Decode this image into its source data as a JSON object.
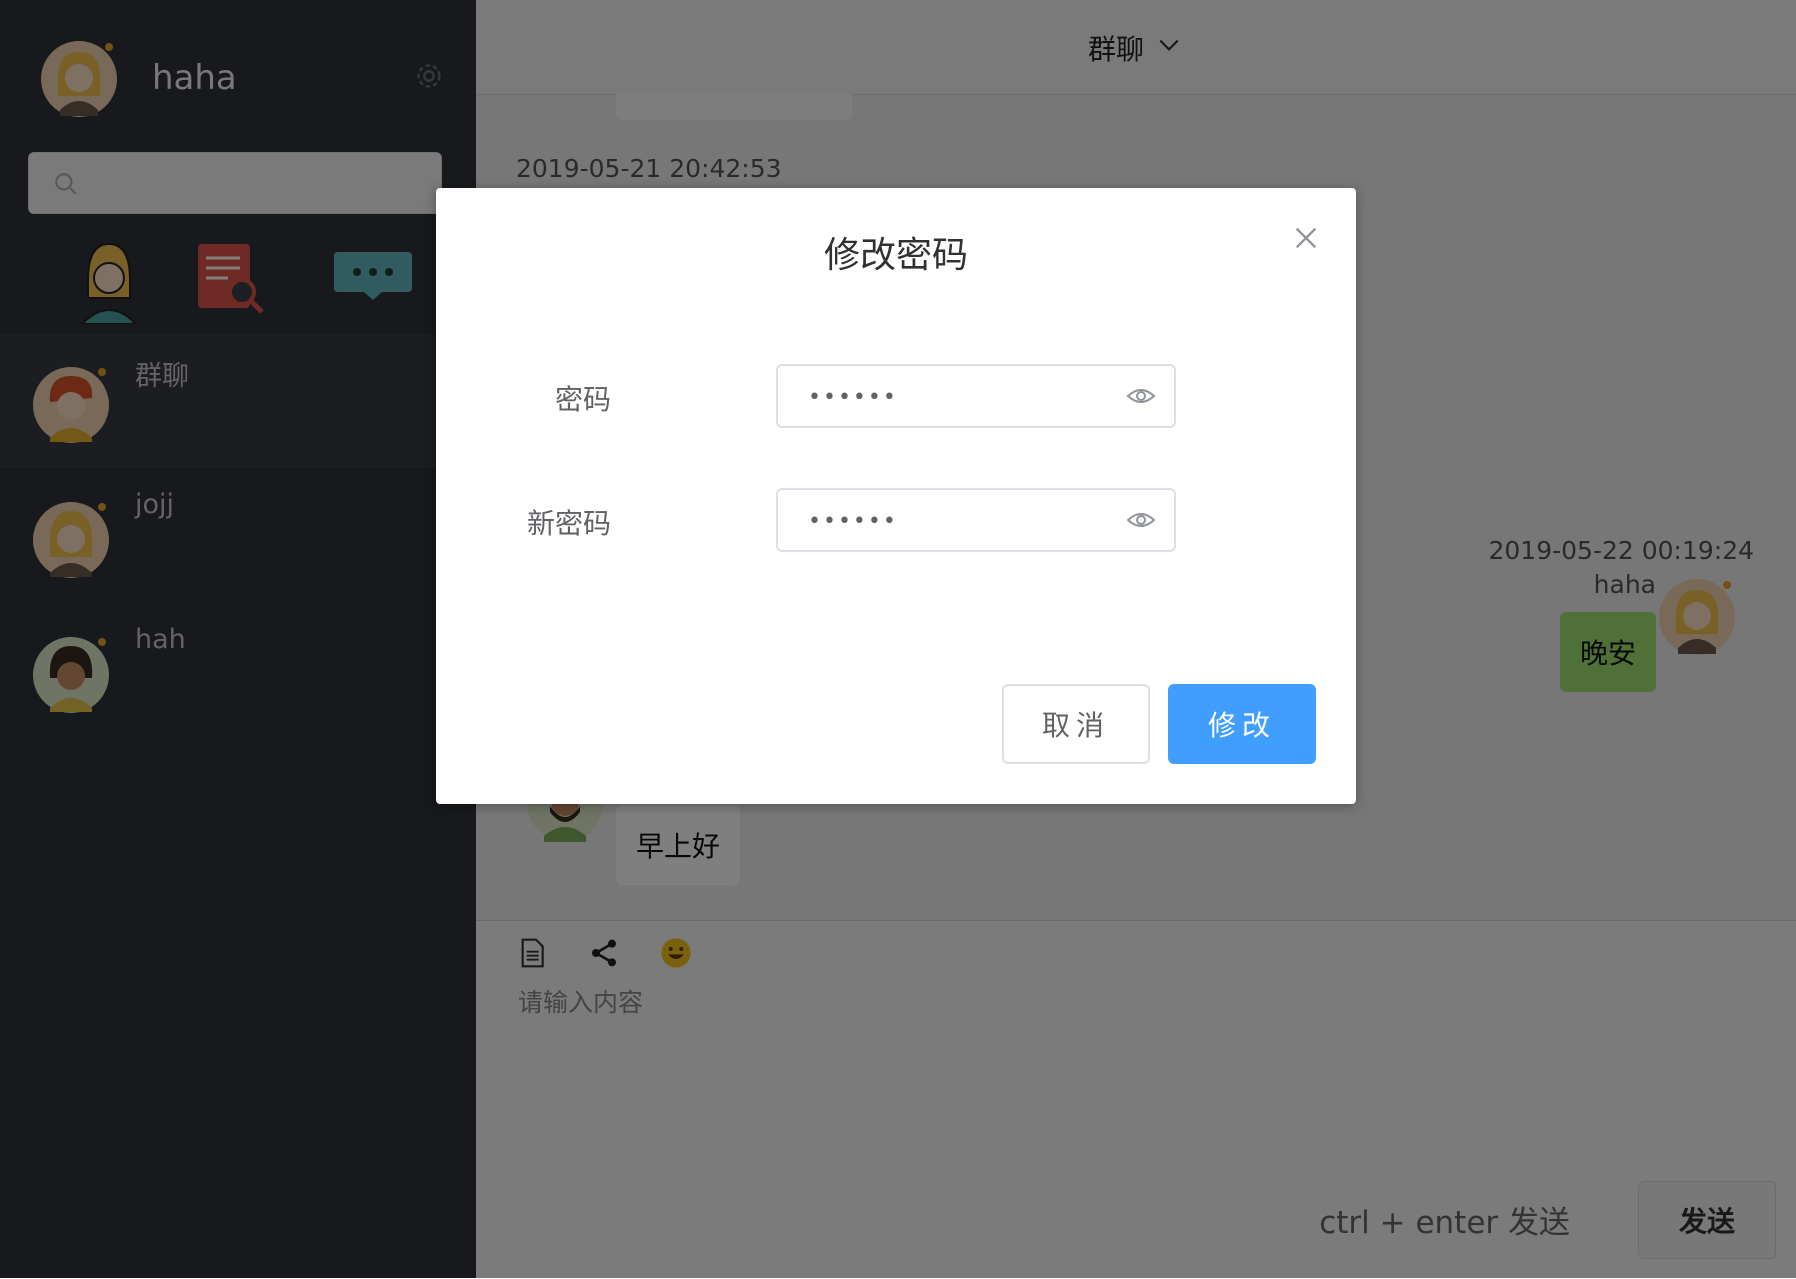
{
  "user": {
    "name": "haha"
  },
  "sidebar": {
    "search_placeholder": "",
    "conversations": [
      {
        "name": "群聊"
      },
      {
        "name": "jojj"
      },
      {
        "name": "hah"
      }
    ]
  },
  "chat": {
    "title": "群聊",
    "messages": [
      {
        "time": "2019-05-21 20:42:53"
      },
      {
        "time": "2019-05-22 00:19:24",
        "sender": "haha",
        "text": "晚安"
      },
      {
        "text": "早上好"
      }
    ]
  },
  "composer": {
    "placeholder": "请输入内容",
    "hint": "ctrl + enter 发送",
    "send_label": "发送"
  },
  "dialog": {
    "title": "修改密码",
    "password_label": "密码",
    "password_value": "123456",
    "new_password_label": "新密码",
    "new_password_value": "123456",
    "cancel_label": "取消",
    "confirm_label": "修改"
  },
  "colors": {
    "sidebar": "#2e3238",
    "primary": "#409eff",
    "bubble_self": "#9ee36e"
  }
}
